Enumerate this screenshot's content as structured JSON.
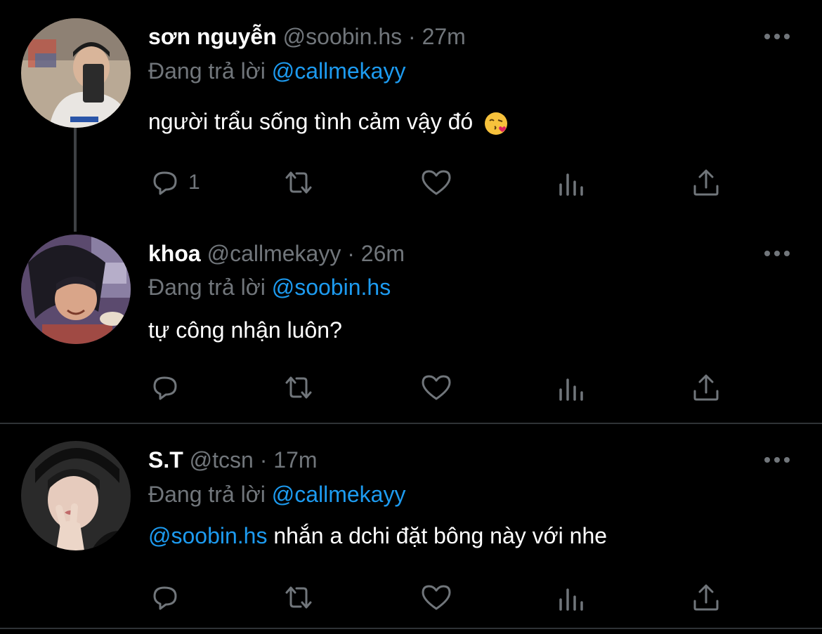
{
  "tweets": [
    {
      "name": "sơn nguyễn",
      "handle": "@soobin.hs",
      "separator": "·",
      "time": "27m",
      "reply_prefix": "Đang trả lời",
      "reply_to": "@callmekayy",
      "body_mention": "",
      "body_text": "người trẩu sống tình cảm vậy đó",
      "emoji": "kissing-face-emoji",
      "reply_count": "1"
    },
    {
      "name": "khoa",
      "handle": "@callmekayy",
      "separator": "·",
      "time": "26m",
      "reply_prefix": "Đang trả lời",
      "reply_to": "@soobin.hs",
      "body_mention": "",
      "body_text": "tự công nhận luôn?",
      "reply_count": ""
    },
    {
      "name": "S.T",
      "handle": "@tcsn",
      "separator": "·",
      "time": "17m",
      "reply_prefix": "Đang trả lời",
      "reply_to": "@callmekayy",
      "body_mention": "@soobin.hs",
      "body_text": "nhắn a dchi đặt bông này với nhe",
      "reply_count": ""
    }
  ],
  "icons": {
    "reply": "reply-icon",
    "retweet": "retweet-icon",
    "like": "heart-icon",
    "views": "analytics-icon",
    "share": "share-icon",
    "more": "more-icon"
  },
  "colors": {
    "background": "#000000",
    "text": "#ffffff",
    "secondary": "#71767b",
    "accent": "#1d9bf0",
    "divider": "#2f3336"
  }
}
